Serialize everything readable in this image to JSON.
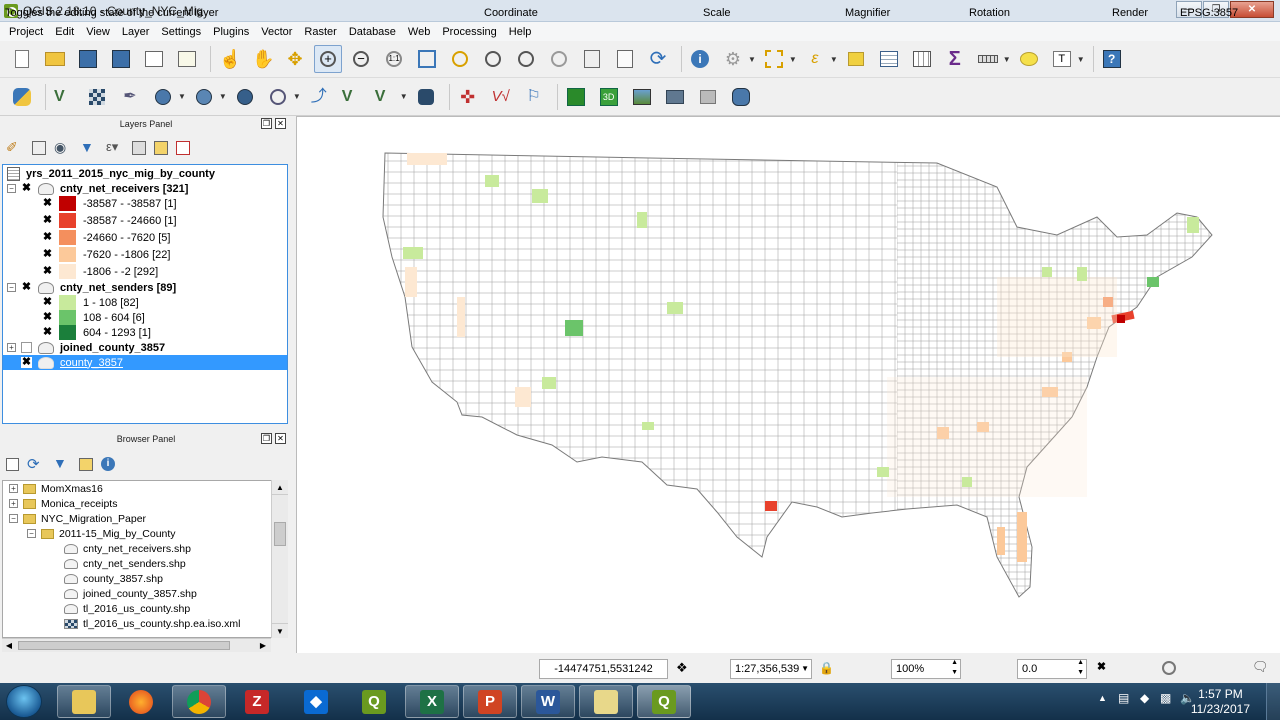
{
  "window": {
    "title": "QGIS 2.18.10 - County_NYC_Mig"
  },
  "menu": [
    "Project",
    "Edit",
    "View",
    "Layer",
    "Settings",
    "Plugins",
    "Vector",
    "Raster",
    "Database",
    "Web",
    "Processing",
    "Help"
  ],
  "layers_panel": {
    "title": "Layers Panel",
    "layers": [
      {
        "name": "yrs_2011_2015_nyc_mig_by_county",
        "kind": "table",
        "checked": null
      },
      {
        "name": "cnty_net_receivers [321]",
        "kind": "group",
        "checked": true
      },
      {
        "name": "-38587 - -38587  [1]",
        "kind": "class",
        "color": "#c00000",
        "checked": true
      },
      {
        "name": "-38587 - -24660  [1]",
        "kind": "class",
        "color": "#e8412c",
        "checked": true
      },
      {
        "name": "-24660 - -7620  [5]",
        "kind": "class",
        "color": "#f48f5d",
        "checked": true
      },
      {
        "name": "-7620 - -1806  [22]",
        "kind": "class",
        "color": "#fcc99a",
        "checked": true
      },
      {
        "name": "-1806 - -2  [292]",
        "kind": "class",
        "color": "#fde8d2",
        "checked": true
      },
      {
        "name": "cnty_net_senders [89]",
        "kind": "group",
        "checked": true
      },
      {
        "name": "1 - 108  [82]",
        "kind": "class",
        "color": "#c8ea9c",
        "checked": true
      },
      {
        "name": "108 - 604  [6]",
        "kind": "class",
        "color": "#6bc46a",
        "checked": true
      },
      {
        "name": "604 - 1293  [1]",
        "kind": "class",
        "color": "#1b7f3b",
        "checked": true
      },
      {
        "name": "joined_county_3857",
        "kind": "layer",
        "checked": false
      },
      {
        "name": "county_3857",
        "kind": "layer",
        "checked": true,
        "selected": true
      }
    ]
  },
  "browser_panel": {
    "title": "Browser Panel",
    "items": [
      {
        "name": "MomXmas16",
        "kind": "folder",
        "depth": 0
      },
      {
        "name": "Monica_receipts",
        "kind": "folder",
        "depth": 0
      },
      {
        "name": "NYC_Migration_Paper",
        "kind": "folder",
        "depth": 0
      },
      {
        "name": "2011-15_Mig_by_County",
        "kind": "folder",
        "depth": 1
      },
      {
        "name": "cnty_net_receivers.shp",
        "kind": "file",
        "depth": 2
      },
      {
        "name": "cnty_net_senders.shp",
        "kind": "file",
        "depth": 2
      },
      {
        "name": "county_3857.shp",
        "kind": "file",
        "depth": 2
      },
      {
        "name": "joined_county_3857.shp",
        "kind": "file",
        "depth": 2
      },
      {
        "name": "tl_2016_us_county.shp",
        "kind": "file",
        "depth": 2
      },
      {
        "name": "tl_2016_us_county.shp.ea.iso.xml",
        "kind": "xml",
        "depth": 2
      }
    ]
  },
  "statusbar": {
    "message": "Toggles the editing state of the current layer",
    "coordinate_label": "Coordinate",
    "coordinate": "-14474751,5531242",
    "scale_label": "Scale",
    "scale": "1:27,356,539",
    "magnifier_label": "Magnifier",
    "magnifier": "100%",
    "rotation_label": "Rotation",
    "rotation": "0.0",
    "render_label": "Render",
    "crs": "EPSG:3857"
  },
  "taskbar": {
    "time": "1:57 PM",
    "date": "11/23/2017"
  },
  "colors": {
    "accent_selection": "#3399ff",
    "receivers_ramp": [
      "#c00000",
      "#e8412c",
      "#f48f5d",
      "#fcc99a",
      "#fde8d2"
    ],
    "senders_ramp": [
      "#c8ea9c",
      "#6bc46a",
      "#1b7f3b"
    ]
  }
}
